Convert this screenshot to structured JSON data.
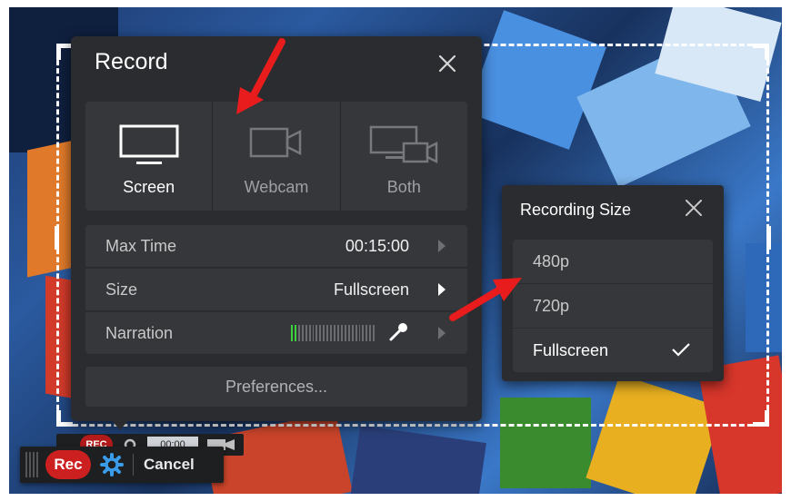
{
  "record_panel": {
    "title": "Record",
    "modes": [
      {
        "label": "Screen",
        "icon": "monitor-icon",
        "selected": true
      },
      {
        "label": "Webcam",
        "icon": "webcam-icon",
        "selected": false
      },
      {
        "label": "Both",
        "icon": "screen-webcam-icon",
        "selected": false
      }
    ],
    "rows": [
      {
        "label": "Max Time",
        "value": "00:15:00"
      },
      {
        "label": "Size",
        "value": "Fullscreen"
      },
      {
        "label": "Narration",
        "value": ""
      }
    ],
    "narration_level": 0.1,
    "preferences_label": "Preferences..."
  },
  "recording_size_panel": {
    "title": "Recording Size",
    "options": [
      {
        "label": "480p",
        "selected": false
      },
      {
        "label": "720p",
        "selected": false
      },
      {
        "label": "Fullscreen",
        "selected": true
      }
    ]
  },
  "toolbar": {
    "rec_label": "Rec",
    "cancel_label": "Cancel"
  },
  "mini_toolbar": {
    "rec_label": "REC",
    "time": "00:00"
  },
  "colors": {
    "panel_bg": "#2a2c2f",
    "row_bg": "#35373a",
    "rec_red": "#cc1f1f",
    "meter_green": "#3fd23f",
    "gear_blue": "#3a9be8",
    "annotation_red": "#e81c1c"
  }
}
